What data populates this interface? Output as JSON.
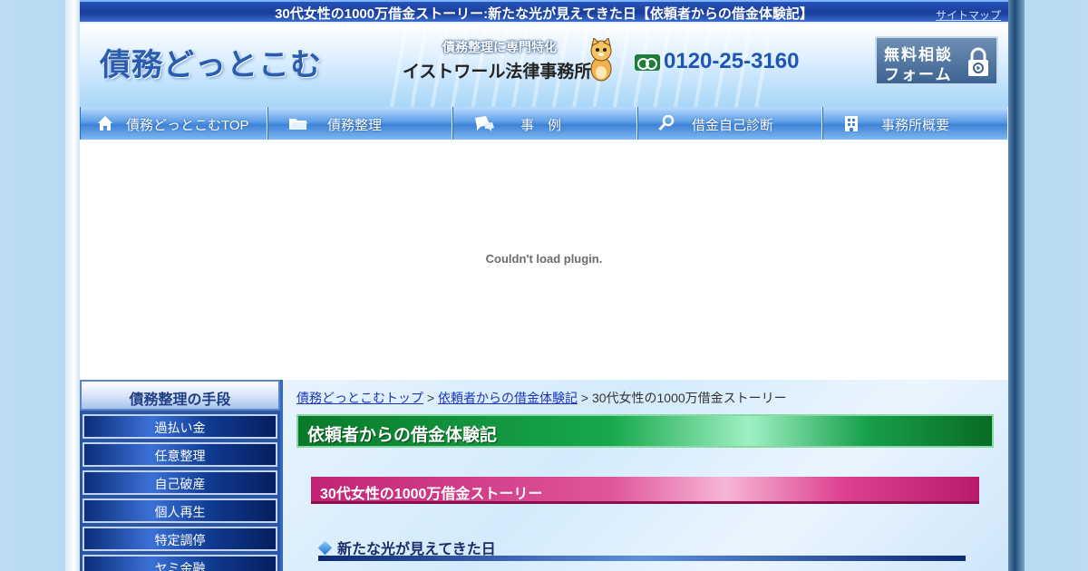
{
  "title_bar": {
    "title": "30代女性の1000万借金ストーリー:新たな光が見えてきた日【依頼者からの借金体験記】",
    "sitemap": "サイトマップ"
  },
  "header": {
    "logo": "債務どっとこむ",
    "tagline": "債務整理に専門特化",
    "firm": "イストワール法律事務所",
    "phone": "0120-25-3160",
    "form_button": {
      "line1": "無料相談",
      "line2": "フォーム"
    }
  },
  "nav": [
    {
      "label": "債務どっとこむTOP",
      "icon": "home-icon"
    },
    {
      "label": "債務整理",
      "icon": "folder-icon"
    },
    {
      "label": "事　例",
      "icon": "chat-icon"
    },
    {
      "label": "借金自己診断",
      "icon": "search-icon"
    },
    {
      "label": "事務所概要",
      "icon": "building-icon"
    }
  ],
  "plugin": {
    "message": "Couldn't load plugin."
  },
  "sidebar": {
    "heading": "債務整理の手段",
    "items": [
      "過払い金",
      "任意整理",
      "自己破産",
      "個人再生",
      "特定調停",
      "ヤミ金融"
    ]
  },
  "main": {
    "breadcrumb": {
      "home": "債務どっとこむトップ",
      "sep": " > ",
      "section": "依頼者からの借金体験記",
      "current": "30代女性の1000万借金ストーリー"
    },
    "section_heading": "依頼者からの借金体験記",
    "story_heading": "30代女性の1000万借金ストーリー",
    "sub_heading": "新たな光が見えてきた日"
  },
  "colors": {
    "title_bar": "#1a3d9a",
    "logo": "#2a5db0",
    "phone": "#1f56b6",
    "section_green": "#17a84b",
    "story_pink": "#c12474",
    "sidebar_blue": "#2b56a3"
  }
}
